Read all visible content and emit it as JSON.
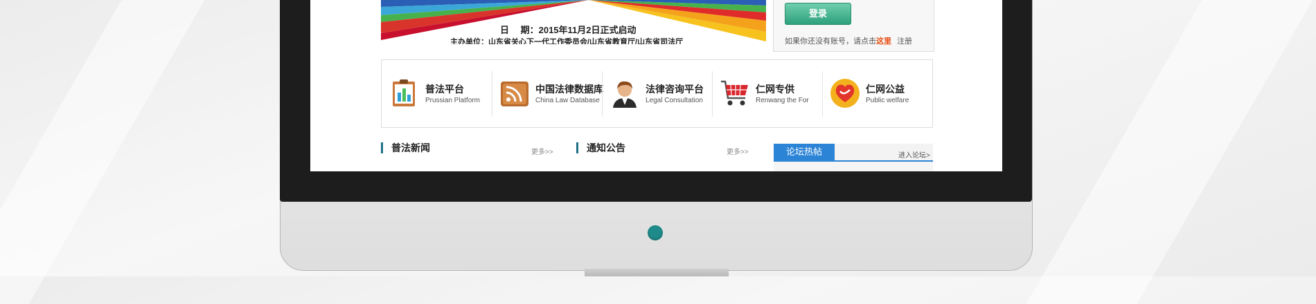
{
  "banner": {
    "date_line": "日　 期：2015年11月2日正式启动",
    "organizer_line": "主办单位：山东省关心下一代工作委员会/山东省教育厅/山东省司法厅"
  },
  "login": {
    "button_label": "登录",
    "hint_prefix": "如果你还没有账号，请点击",
    "hint_link": "这里",
    "register_label": "注册"
  },
  "nav": [
    {
      "title": "普法平台",
      "subtitle": "Prussian Platform",
      "icon": "clipboard-chart-icon"
    },
    {
      "title": "中国法律数据库",
      "subtitle": "China Law Database",
      "icon": "rss-feed-icon"
    },
    {
      "title": "法律咨询平台",
      "subtitle": "Legal Consultation",
      "icon": "consultant-avatar-icon"
    },
    {
      "title": "仁网专供",
      "subtitle": "Renwang the For",
      "icon": "shopping-cart-icon"
    },
    {
      "title": "仁网公益",
      "subtitle": "Public welfare",
      "icon": "heart-charity-icon"
    }
  ],
  "sections": {
    "news_title": "普法新闻",
    "news_more": "更多>>",
    "notice_title": "通知公告",
    "notice_more": "更多>>",
    "forum_tab": "论坛热帖",
    "forum_more": "进入论坛>"
  },
  "colors": {
    "accent_teal": "#1f8a8a",
    "forum_blue": "#2b84d6",
    "login_green": "#2ea07c",
    "link_orange": "#e84a0c"
  }
}
